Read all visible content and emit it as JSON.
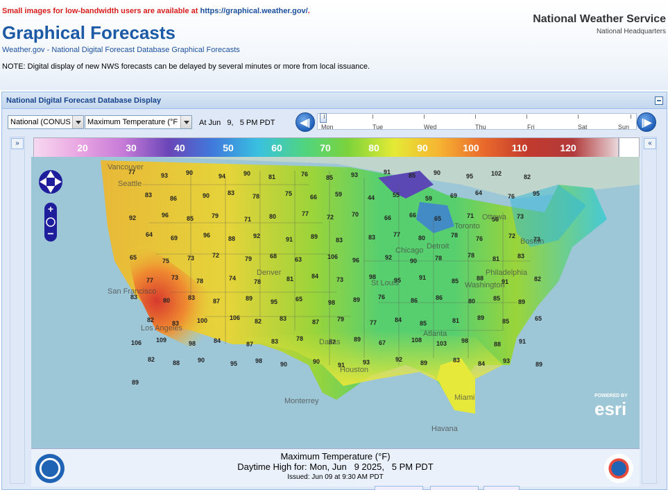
{
  "header": {
    "lowband_text": "Small images for low-bandwidth users are available at ",
    "lowband_link": "https://graphical.weather.gov/",
    "lowband_end": ".",
    "title": "Graphical Forecasts",
    "crumb_home": "Weather.gov",
    "crumb_sep": " - ",
    "crumb_page": "National Digital Forecast Database Graphical Forecasts",
    "note": "NOTE: Digital display of new NWS forecasts can be delayed by several minutes or more from local issuance.",
    "org": "National Weather Service",
    "org_sub": "National Headquarters"
  },
  "panel": {
    "title": "National Digital Forecast Database Display",
    "region_select": "National (CONUS",
    "element_select": "Maximum Temperature (°F",
    "time_label": "At Jun   9,   5 PM PDT",
    "days": [
      "Mon",
      "Tue",
      "Wed",
      "Thu",
      "Fri",
      "Sat",
      "Sun"
    ],
    "prev_icon": "rewind-icon",
    "next_icon": "fast-forward-icon",
    "expand_left": "»",
    "expand_right": "«"
  },
  "legend": {
    "labels": [
      "20",
      "30",
      "40",
      "50",
      "60",
      "70",
      "80",
      "90",
      "100",
      "110",
      "120"
    ],
    "colors": [
      "#f7d8f0",
      "#e9a6e2",
      "#c67ad7",
      "#6a46b8",
      "#3f7bdc",
      "#39c1e0",
      "#4fd482",
      "#7cd33a",
      "#e4ea36",
      "#f6b532",
      "#ea6a2c",
      "#c23a2e",
      "#b23a3a",
      "#e8d7db"
    ]
  },
  "map": {
    "cities": [
      {
        "name": "Vancouver"
      },
      {
        "name": "Seattle"
      },
      {
        "name": "San Francisco"
      },
      {
        "name": "Los Angeles"
      },
      {
        "name": "Denver"
      },
      {
        "name": "Dallas"
      },
      {
        "name": "Houston"
      },
      {
        "name": "Chicago"
      },
      {
        "name": "St Louis"
      },
      {
        "name": "Detroit"
      },
      {
        "name": "Toronto"
      },
      {
        "name": "Ottawa"
      },
      {
        "name": "Boston"
      },
      {
        "name": "Philadelphia"
      },
      {
        "name": "Washington"
      },
      {
        "name": "Atlanta"
      },
      {
        "name": "Miami"
      },
      {
        "name": "Havana"
      },
      {
        "name": "Monterrey"
      }
    ],
    "temps": [
      "77",
      "93",
      "90",
      "94",
      "90",
      "81",
      "76",
      "85",
      "93",
      "91",
      "85",
      "90",
      "95",
      "102",
      "82",
      "83",
      "86",
      "90",
      "83",
      "78",
      "75",
      "66",
      "59",
      "44",
      "55",
      "59",
      "69",
      "64",
      "76",
      "95",
      "92",
      "96",
      "85",
      "79",
      "71",
      "80",
      "77",
      "72",
      "70",
      "66",
      "66",
      "65",
      "71",
      "56",
      "73",
      "64",
      "69",
      "96",
      "88",
      "92",
      "91",
      "89",
      "83",
      "83",
      "77",
      "80",
      "78",
      "76",
      "72",
      "73",
      "65",
      "75",
      "73",
      "72",
      "79",
      "68",
      "63",
      "106",
      "96",
      "92",
      "90",
      "78",
      "78",
      "81",
      "83",
      "77",
      "73",
      "78",
      "74",
      "78",
      "81",
      "84",
      "73",
      "98",
      "95",
      "91",
      "85",
      "88",
      "91",
      "82",
      "83",
      "80",
      "83",
      "87",
      "89",
      "95",
      "65",
      "98",
      "89",
      "76",
      "86",
      "86",
      "80",
      "85",
      "89",
      "82",
      "83",
      "100",
      "106",
      "82",
      "83",
      "87",
      "79",
      "77",
      "84",
      "85",
      "81",
      "89",
      "85",
      "65",
      "106",
      "109",
      "98",
      "84",
      "87",
      "83",
      "78",
      "87",
      "89",
      "67",
      "108",
      "103",
      "98",
      "88",
      "91",
      "82",
      "88",
      "90",
      "95",
      "98",
      "90",
      "90",
      "91",
      "93",
      "92",
      "89",
      "83",
      "84",
      "93",
      "89",
      "89"
    ],
    "powered": "POWERED BY",
    "esri": "esri"
  },
  "footer": {
    "line1": "Maximum Temperature (°F)",
    "line2": "Daytime High for: Mon, Jun   9 2025,   5 PM PDT",
    "line3": "Issued: Jun 09 at 9:30 AM PDT"
  }
}
